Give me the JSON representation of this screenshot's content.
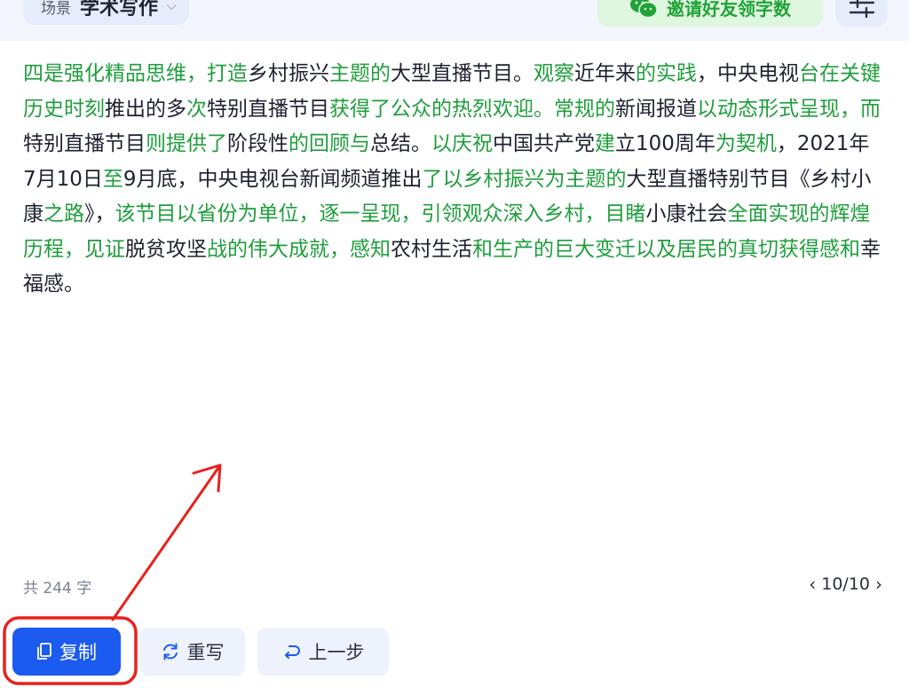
{
  "top_bar": {
    "scene_label": "场景",
    "scene_value": "学术写作",
    "invite_label": "邀请好友领字数"
  },
  "result": {
    "segments": [
      {
        "t": "四是强化精品思维，打造",
        "g": true
      },
      {
        "t": "乡村振兴",
        "g": false
      },
      {
        "t": "主题的",
        "g": true
      },
      {
        "t": "大型直播节目。",
        "g": false
      },
      {
        "t": "观察",
        "g": true
      },
      {
        "t": "近年来",
        "g": false
      },
      {
        "t": "的实践",
        "g": true
      },
      {
        "t": "，中央电视",
        "g": false
      },
      {
        "t": "台在关键历史时刻",
        "g": true
      },
      {
        "t": "推出的多",
        "g": false
      },
      {
        "t": "次",
        "g": true
      },
      {
        "t": "特别直播节目",
        "g": false
      },
      {
        "t": "获得了公众的热烈欢迎。常规的",
        "g": true
      },
      {
        "t": "新闻报道",
        "g": false
      },
      {
        "t": "以动态形式呈现，而",
        "g": true
      },
      {
        "t": "特别直播节目",
        "g": false
      },
      {
        "t": "则提供了",
        "g": true
      },
      {
        "t": "阶段性",
        "g": false
      },
      {
        "t": "的回顾与",
        "g": true
      },
      {
        "t": "总结。",
        "g": false
      },
      {
        "t": "以庆祝",
        "g": true
      },
      {
        "t": "中国共产党",
        "g": false
      },
      {
        "t": "建",
        "g": true
      },
      {
        "t": "立100周年",
        "g": false
      },
      {
        "t": "为契机",
        "g": true
      },
      {
        "t": "，2021年7月10日",
        "g": false
      },
      {
        "t": "至",
        "g": true
      },
      {
        "t": "9月底，中央电视台新闻频道推出",
        "g": false
      },
      {
        "t": "了以乡村振兴为主题的",
        "g": true
      },
      {
        "t": "大型直播特别节目《乡村小康",
        "g": false
      },
      {
        "t": "之路",
        "g": true
      },
      {
        "t": "》，",
        "g": false
      },
      {
        "t": "该节目以省份为单位，逐一呈现，引领观众深入乡村，目睹",
        "g": true
      },
      {
        "t": "小康社会",
        "g": false
      },
      {
        "t": "全面实现的辉煌历程，见证",
        "g": true
      },
      {
        "t": "脱贫攻坚",
        "g": false
      },
      {
        "t": "战的伟大成就，感知",
        "g": true
      },
      {
        "t": "农村生活",
        "g": false
      },
      {
        "t": "和生产的巨大变迁以及居民的真切获得感和",
        "g": true
      },
      {
        "t": "幸福感。",
        "g": false
      }
    ],
    "highlight_color": "#1f9e3c"
  },
  "footer": {
    "char_count": "共 244 字",
    "pager_prev_icon": "chevron-left-icon",
    "pager_text": "10/10",
    "pager_next_icon": "chevron-right-icon"
  },
  "actions": {
    "copy_label": "复制",
    "rewrite_label": "重写",
    "undo_label": "上一步"
  },
  "annotation": {
    "color": "#e8211b"
  }
}
